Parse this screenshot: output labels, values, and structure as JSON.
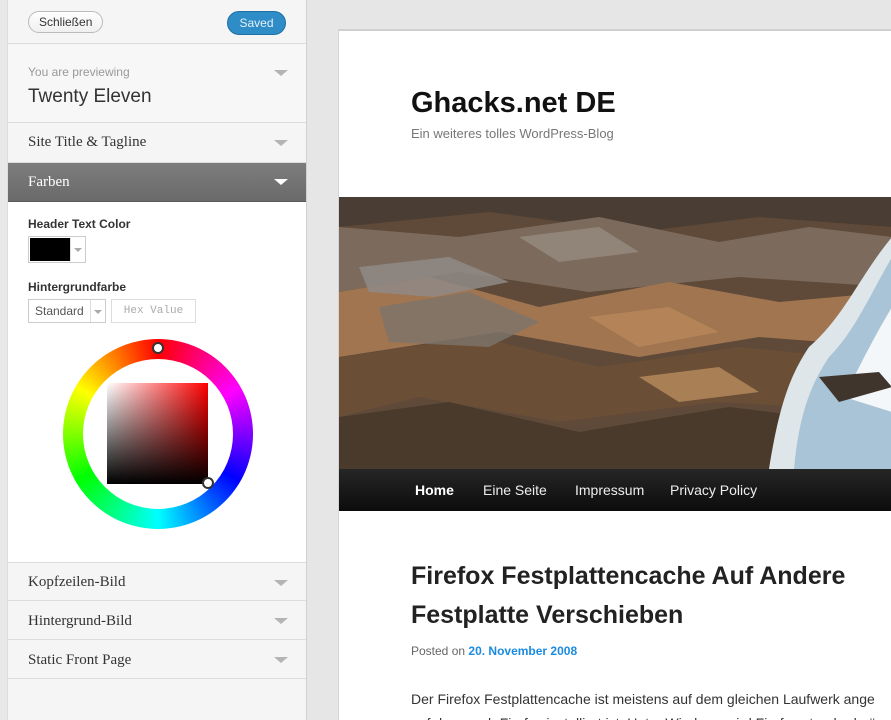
{
  "sidebar": {
    "close_label": "Schließen",
    "saved_label": "Saved",
    "preview_label": "You are previewing",
    "theme_name": "Twenty Eleven",
    "sections": {
      "site_title": "Site Title & Tagline",
      "farben": "Farben",
      "kopfzeilen": "Kopfzeilen-Bild",
      "hintergrund": "Hintergrund-Bild",
      "static_front": "Static Front Page"
    },
    "farben_panel": {
      "header_text_color_label": "Header Text Color",
      "header_text_color": "#000000",
      "background_label": "Hintergrundfarbe",
      "background_value": "Standard",
      "hex_placeholder": "Hex Value"
    }
  },
  "preview": {
    "site_title": "Ghacks.net DE",
    "tagline": "Ein weiteres tolles WordPress-Blog",
    "nav": [
      "Home",
      "Eine Seite",
      "Impressum",
      "Privacy Policy"
    ],
    "post_title": "Firefox Festplattencache Auf Andere Festplatte Verschieben",
    "meta_prefix": "Posted on",
    "meta_date": "20. November 2008",
    "excerpt_line1": "Der Firefox Festplattencache ist meistens auf dem gleichen Laufwerk ange",
    "excerpt_line2": "auf dem auch Firefox installiert ist. Unter Windows wird Firefox standardmä"
  },
  "colors": {
    "accent": "#2e8cc6",
    "active_section": "#737373",
    "link": "#1b8be0"
  }
}
